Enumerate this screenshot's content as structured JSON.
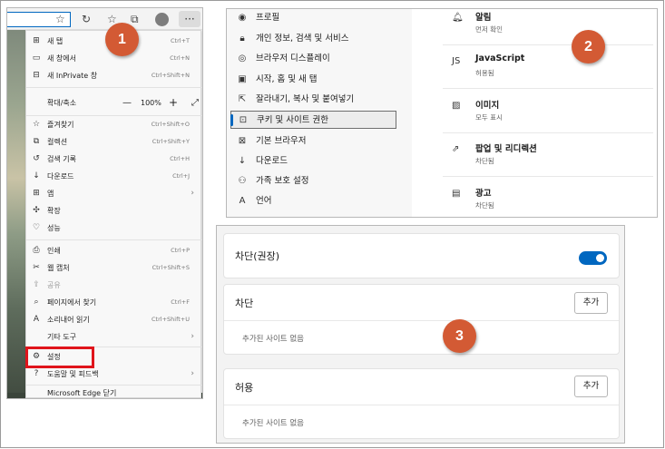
{
  "badges": {
    "one": "1",
    "two": "2",
    "three": "3"
  },
  "colors": {
    "accent": "#0067c0",
    "highlight": "#e0141b",
    "badge": "#d35a34"
  },
  "panel1": {
    "browser_menu": [
      {
        "icon": "new-tab-icon",
        "label": "새 탭",
        "shortcut": "Ctrl+T"
      },
      {
        "icon": "new-window-icon",
        "label": "새 창에서",
        "shortcut": "Ctrl+N"
      },
      {
        "icon": "inprivate-icon",
        "label": "새 InPrivate 창",
        "shortcut": "Ctrl+Shift+N"
      }
    ],
    "zoom": {
      "label": "확대/축소",
      "minus": "—",
      "value": "100%",
      "plus": "+",
      "fullscreen": "⤢"
    },
    "group2": [
      {
        "icon": "favorites-icon",
        "label": "즐겨찾기",
        "shortcut": "Ctrl+Shift+O"
      },
      {
        "icon": "collections-icon",
        "label": "컬렉션",
        "shortcut": "Ctrl+Shift+Y"
      },
      {
        "icon": "history-icon",
        "label": "검색 기록",
        "shortcut": "Ctrl+H"
      },
      {
        "icon": "download-icon",
        "label": "다운로드",
        "shortcut": "Ctrl+J"
      },
      {
        "icon": "apps-icon",
        "label": "앱",
        "shortcut": ""
      },
      {
        "icon": "extensions-icon",
        "label": "확장",
        "shortcut": ""
      },
      {
        "icon": "performance-icon",
        "label": "성능",
        "shortcut": ""
      }
    ],
    "group3": [
      {
        "icon": "print-icon",
        "label": "인쇄",
        "shortcut": "Ctrl+P"
      },
      {
        "icon": "web-capture-icon",
        "label": "웹 캡처",
        "shortcut": "Ctrl+Shift+S"
      },
      {
        "icon": "share-icon",
        "label": "공유",
        "shortcut": ""
      },
      {
        "icon": "find-icon",
        "label": "페이지에서 찾기",
        "shortcut": "Ctrl+F"
      },
      {
        "icon": "read-aloud-icon",
        "label": "소리내어 읽기",
        "shortcut": "Ctrl+Shift+U"
      },
      {
        "icon": "",
        "label": "기타 도구",
        "shortcut": ""
      }
    ],
    "group4": [
      {
        "icon": "settings-icon",
        "label": "설정",
        "shortcut": ""
      },
      {
        "icon": "help-icon",
        "label": "도움말 및 피드백",
        "shortcut": ""
      }
    ],
    "close_edge": "Microsoft Edge 닫기"
  },
  "panel2": {
    "nav": [
      {
        "icon": "profile-icon",
        "label": "프로필"
      },
      {
        "icon": "privacy-lock-icon",
        "label": "개인 정보, 검색 및 서비스"
      },
      {
        "icon": "appearance-icon",
        "label": "브라우저 디스플레이"
      },
      {
        "icon": "start-page-icon",
        "label": "시작, 홈 및 새 탭"
      },
      {
        "icon": "share-copy-icon",
        "label": "잘라내기, 복사 및 붙여넣기"
      },
      {
        "icon": "cookies-permissions-icon",
        "label": "쿠키 및 사이트 권한"
      },
      {
        "icon": "default-browser-icon",
        "label": "기본 브라우저"
      },
      {
        "icon": "download-icon",
        "label": "다운로드"
      },
      {
        "icon": "family-icon",
        "label": "가족 보호 설정"
      },
      {
        "icon": "language-icon",
        "label": "언어"
      }
    ],
    "permissions": [
      {
        "icon": "bell-icon",
        "title": "알림",
        "status": "먼저 확인"
      },
      {
        "icon": "javascript-icon",
        "title": "JavaScript",
        "status": "허용됨"
      },
      {
        "icon": "image-icon",
        "title": "이미지",
        "status": "모두 표시"
      },
      {
        "icon": "popup-icon",
        "title": "팝업 및 리디렉션",
        "status": "차단됨"
      },
      {
        "icon": "ads-icon",
        "title": "광고",
        "status": "차단됨"
      }
    ]
  },
  "panel3": {
    "blocked_recommended": "차단(권장)",
    "toggle_on": true,
    "block": {
      "title": "차단",
      "add": "추가",
      "empty": "추가된 사이트 없음"
    },
    "allow": {
      "title": "허용",
      "add": "추가",
      "empty": "추가된 사이트 없음"
    }
  }
}
